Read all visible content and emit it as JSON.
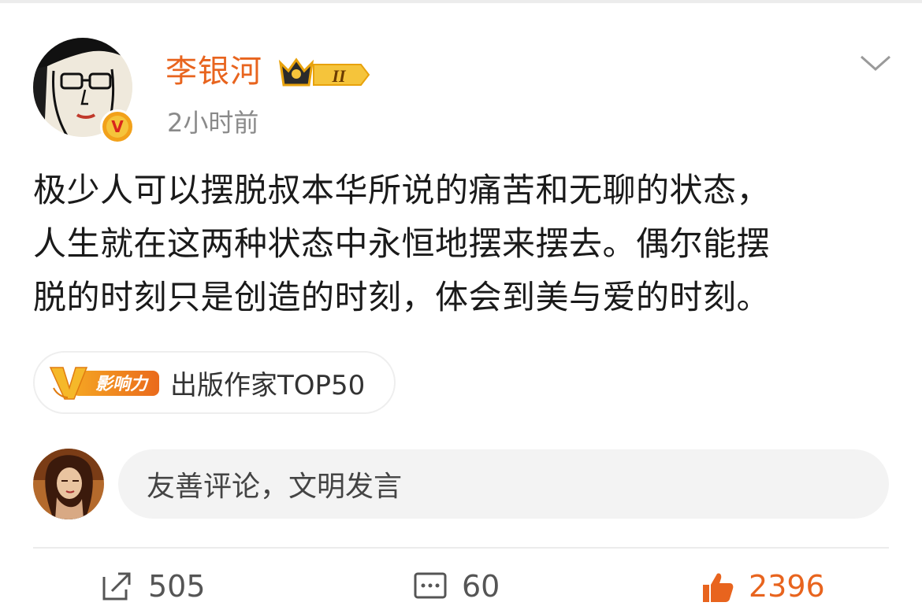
{
  "post": {
    "author": {
      "name": "李银河",
      "member_level": "II",
      "verified_badge": "V"
    },
    "timestamp": "2小时前",
    "content_lines": [
      "极少人可以摆脱叔本华所说的痛苦和无聊的状态，",
      "人生就在这两种状态中永恒地摆来摆去。偶尔能摆",
      "脱的时刻只是创造的时刻，体会到美与爱的时刻。"
    ],
    "tag": {
      "badge_label": "影响力",
      "text": "出版作家TOP50"
    },
    "comment": {
      "placeholder": "友善评论，文明发言"
    },
    "actions": {
      "reposts": "505",
      "comments": "60",
      "likes": "2396"
    }
  },
  "colors": {
    "username": "#e8641e",
    "like_active": "#e8641e",
    "timestamp": "#8a8a8a",
    "badge_orange": "#f2a11a"
  },
  "icons": [
    "chevron-down-icon",
    "crown-level-icon",
    "verified-v-icon",
    "repost-icon",
    "comment-icon",
    "like-icon"
  ]
}
